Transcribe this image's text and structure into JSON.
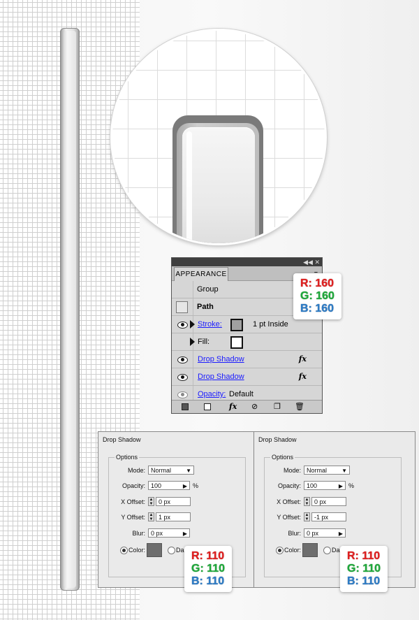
{
  "appearance": {
    "title": "APPEARANCE",
    "menu_glyph": "≡",
    "titlebar_buttons": "◀◀ ✕",
    "rows": [
      {
        "label": "Group"
      },
      {
        "label": "Path"
      },
      {
        "label": "Stroke:",
        "value": "1 pt  Inside"
      },
      {
        "label": "Fill:"
      },
      {
        "label": "Drop Shadow"
      },
      {
        "label": "Drop Shadow"
      },
      {
        "label": "Opacity:",
        "value": "Default"
      }
    ],
    "fx": "fx",
    "bottom": {
      "fx": "fx"
    }
  },
  "badge_stroke": {
    "r": "R: 160",
    "g": "G: 160",
    "b": "B: 160"
  },
  "badge_shadow": {
    "r": "R: 110",
    "g": "G: 110",
    "b": "B: 110"
  },
  "colors": {
    "stroke": "#a0a0a0",
    "shadow": "#6e6e6e"
  },
  "dialogs": [
    {
      "title": "Drop Shadow",
      "options": "Options",
      "mode_label": "Mode:",
      "mode_value": "Normal",
      "opacity_label": "Opacity:",
      "opacity_value": "100",
      "opacity_unit": "%",
      "xoffset_label": "X Offset:",
      "xoffset_value": "0 px",
      "yoffset_label": "Y Offset:",
      "yoffset_value": "1 px",
      "blur_label": "Blur:",
      "blur_value": "0 px",
      "color_label": "Color:",
      "dark_label": "Da"
    },
    {
      "title": "Drop Shadow",
      "options": "Options",
      "mode_label": "Mode:",
      "mode_value": "Normal",
      "opacity_label": "Opacity:",
      "opacity_value": "100",
      "opacity_unit": "%",
      "xoffset_label": "X Offset:",
      "xoffset_value": "0 px",
      "yoffset_label": "Y Offset:",
      "yoffset_value": "-1 px",
      "blur_label": "Blur:",
      "blur_value": "0 px",
      "color_label": "Color:",
      "dark_label": "Da"
    }
  ]
}
